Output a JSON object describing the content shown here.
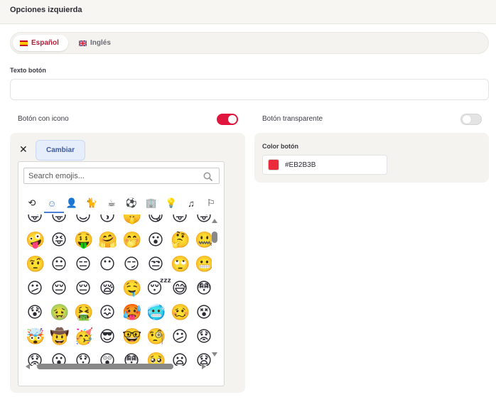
{
  "header": {
    "title": "Opciones izquierda"
  },
  "languages": [
    {
      "label": "Español",
      "active": true
    },
    {
      "label": "Inglés",
      "active": false
    }
  ],
  "fields": {
    "button_text_label": "Texto botón",
    "button_text_value": "",
    "button_icon_label": "Botón con icono",
    "button_icon_on": true,
    "transparent_label": "Botón transparente",
    "transparent_on": false,
    "color_label": "Color botón",
    "color_value": "#EB2B3B"
  },
  "icon_panel": {
    "close_symbol": "✕",
    "change_label": "Cambiar"
  },
  "emoji_picker": {
    "search_placeholder": "Search emojis...",
    "categories": [
      {
        "name": "recent",
        "glyph": "⟲"
      },
      {
        "name": "smileys",
        "glyph": "☺"
      },
      {
        "name": "people",
        "glyph": "👤"
      },
      {
        "name": "animals",
        "glyph": "🐈"
      },
      {
        "name": "food",
        "glyph": "☕"
      },
      {
        "name": "activities",
        "glyph": "⚽"
      },
      {
        "name": "travel",
        "glyph": "🏢"
      },
      {
        "name": "objects",
        "glyph": "💡"
      },
      {
        "name": "symbols",
        "glyph": "♫"
      },
      {
        "name": "flags",
        "glyph": "⚐"
      }
    ],
    "rows": [
      [
        "😜",
        "😛",
        "😊",
        "😚",
        "🤫",
        "😋",
        "😛",
        "😜"
      ],
      [
        "🤪",
        "😝",
        "🤑",
        "🤗",
        "🤭",
        "😮",
        "🤔",
        "🤐"
      ],
      [
        "🤨",
        "😐",
        "😑",
        "😶",
        "😏",
        "😒",
        "🙄",
        "😬"
      ],
      [
        "😕",
        "😔",
        "😔",
        "😪",
        "🤤",
        "😴",
        "😅",
        "😳"
      ],
      [
        "😰",
        "🤢",
        "🤮",
        "😖",
        "🥵",
        "🥶",
        "🥴",
        "😵"
      ],
      [
        "🤯",
        "🤠",
        "🥳",
        "😎",
        "🤓",
        "🧐",
        "😕",
        "😟"
      ],
      [
        "😟",
        "😮",
        "😯",
        "😲",
        "😳",
        "🥺",
        "😦",
        "😧"
      ]
    ],
    "accent_color": "#4a7fd9"
  },
  "colors": {
    "accent": "#e0163f",
    "button_color": "#EB2B3B"
  }
}
